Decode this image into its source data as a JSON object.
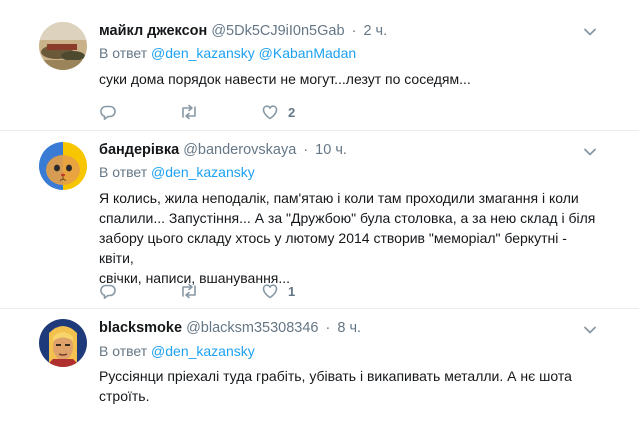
{
  "reply_prefix": "В ответ",
  "tweets": [
    {
      "name": "майкл джексон",
      "handle": "@5Dk5CJ9iI0n5Gab",
      "separator": "·",
      "time": "2 ч.",
      "reply_to": [
        "@den_kazansky",
        "@KabanMadan"
      ],
      "text": "суки дома порядок навести не могут...лезут по соседям...",
      "counts": {
        "reply": "",
        "retweet": "",
        "like": "2"
      }
    },
    {
      "name": "бандерівка",
      "handle": "@banderovskaya",
      "separator": "·",
      "time": "10 ч.",
      "reply_to": [
        "@den_kazansky"
      ],
      "text_lines": [
        "Я колись, жила неподалік, пам'ятаю і коли там проходили змагання і коли",
        "спалили... Запустіння... А за \"Дружбою\" була столовка, а за нею склад і біля",
        "забору цього складу хтось у лютому 2014 створив \"меморіал\" беркутні - квіти,",
        "свічки, написи, вшанування..."
      ],
      "counts": {
        "reply": "",
        "retweet": "",
        "like": "1"
      }
    },
    {
      "name": "blacksmoke",
      "handle": "@blacksm35308346",
      "separator": "·",
      "time": "8 ч.",
      "reply_to": [
        "@den_kazansky"
      ],
      "text_lines": [
        "Руссіянци пріехалі туда грабіть, убівать і викапивать металли. А нє шота",
        "строїть."
      ],
      "counts": {
        "reply": "",
        "retweet": "",
        "like": ""
      }
    }
  ],
  "icons": {
    "reply": "reply-icon",
    "retweet": "retweet-icon",
    "like": "heart-icon",
    "menu": "chevron-down-icon"
  },
  "colors": {
    "mention": "#1da1f2",
    "secondary": "#657786",
    "divider": "#e6ecf0",
    "icon": "#8899a6"
  }
}
